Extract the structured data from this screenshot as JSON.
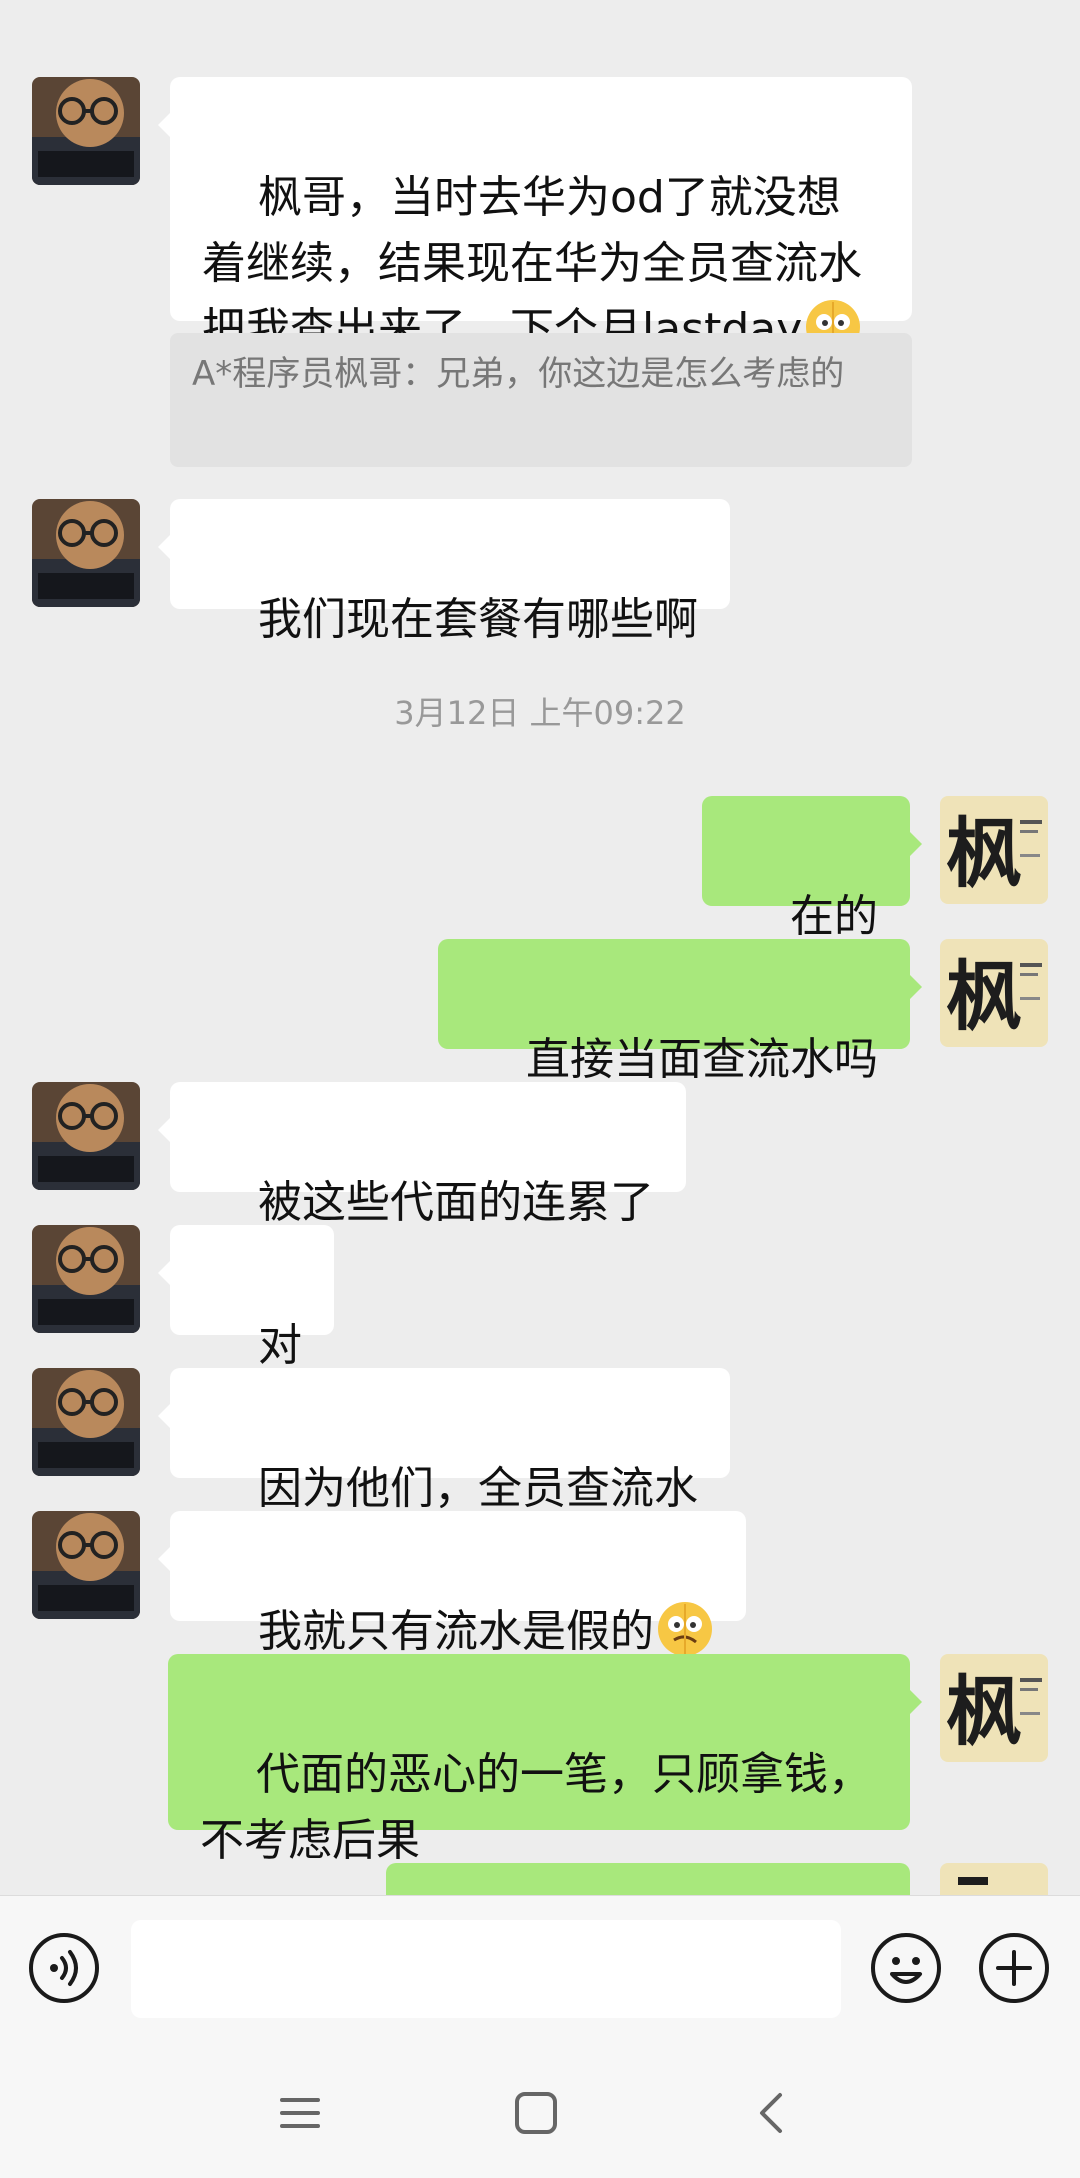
{
  "messages": [
    {
      "side": "in",
      "text": "枫哥，当时去华为od了就没想着继续，结果现在华为全员查流水把我查出来了，下个月lastday",
      "emoji": "smirk-emoji"
    },
    {
      "side": "quote",
      "text": "A*程序员枫哥：兄弟，你这边是怎么考虑的"
    },
    {
      "side": "in",
      "text": "我们现在套餐有哪些啊"
    },
    {
      "side": "time",
      "text": "3月12日 上午09:22"
    },
    {
      "side": "out",
      "text": "在的"
    },
    {
      "side": "out",
      "text": "直接当面查流水吗"
    },
    {
      "side": "in",
      "text": "被这些代面的连累了"
    },
    {
      "side": "in",
      "text": "对"
    },
    {
      "side": "in",
      "text": "因为他们，全员查流水"
    },
    {
      "side": "in",
      "text": "我就只有流水是假的",
      "emoji": "smirk-emoji"
    },
    {
      "side": "out",
      "text": "代面的恶心的一笔，只顾拿钱，不考虑后果"
    }
  ],
  "avatars": {
    "contact_label": "contact-avatar",
    "self_glyph": "枫"
  },
  "input": {
    "value": "",
    "placeholder": ""
  },
  "icons": {
    "voice": "voice-icon",
    "emoji": "emoji-icon",
    "plus": "plus-icon",
    "nav_menu": "menu-icon",
    "nav_home": "home-icon",
    "nav_back": "back-icon"
  },
  "colors": {
    "outgoing_bubble": "#a8e87c",
    "incoming_bubble": "#ffffff",
    "background": "#ededed"
  }
}
